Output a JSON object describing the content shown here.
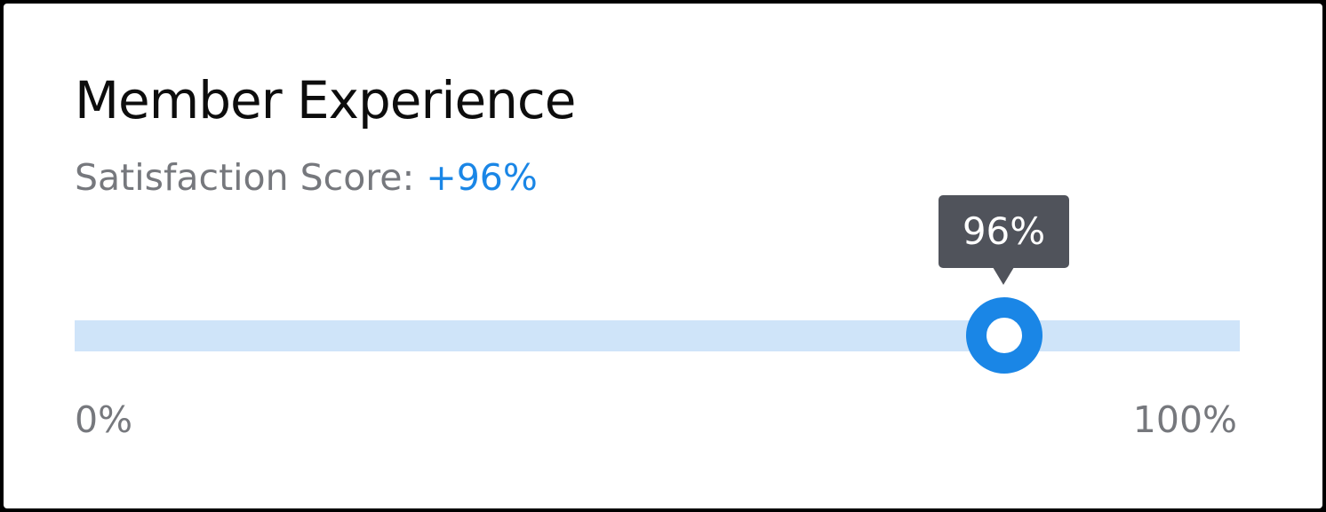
{
  "card": {
    "title": "Member Experience",
    "subtitle_label": "Satisfaction Score:",
    "subtitle_value": "+96%"
  },
  "slider": {
    "value_percent": 96,
    "tooltip_text": "96%",
    "min_label": "0%",
    "max_label": "100%"
  },
  "colors": {
    "accent": "#1a86e6",
    "track": "#cfe4f9",
    "tooltip_bg": "#50535b",
    "muted_text": "#76787d",
    "title_text": "#0d0d0d"
  }
}
